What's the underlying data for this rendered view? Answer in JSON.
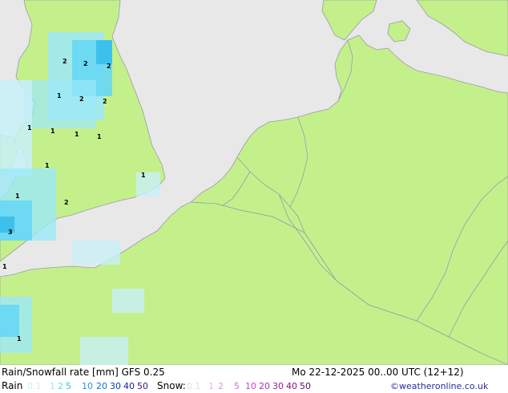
{
  "title": "Rain/Snowfall rate [mm] GFS 0.25",
  "datetime": "Mo 22-12-2025 00..00 UTC (12+12)",
  "credit": "©weatheronline.co.uk",
  "legend": {
    "rain_label": "Rain",
    "snow_label": "Snow:",
    "rain_values": [
      {
        "text": "0.1",
        "color": "#c8f0f8"
      },
      {
        "text": "1",
        "color": "#9ce8f8"
      },
      {
        "text": "2",
        "color": "#64d6f4"
      },
      {
        "text": "5",
        "color": "#34bcec"
      },
      {
        "text": "10",
        "color": "#1c9ce8"
      },
      {
        "text": "20",
        "color": "#1470d0"
      },
      {
        "text": "30",
        "color": "#103cb8"
      },
      {
        "text": "40",
        "color": "#1c1c9c"
      },
      {
        "text": "50",
        "color": "#3c1480"
      }
    ],
    "snow_values": [
      {
        "text": "0.1",
        "color": "#f4d4f4"
      },
      {
        "text": "1",
        "color": "#eab4ea"
      },
      {
        "text": "2",
        "color": "#e090e0"
      },
      {
        "text": "5",
        "color": "#d868d8"
      },
      {
        "text": "10",
        "color": "#c848c8"
      },
      {
        "text": "20",
        "color": "#b030b0"
      },
      {
        "text": "30",
        "color": "#961c96"
      },
      {
        "text": "40",
        "color": "#7c107c"
      },
      {
        "text": "50",
        "color": "#620862"
      }
    ]
  },
  "map_labels": [
    "2",
    "2",
    "2",
    "1",
    "2",
    "2",
    "1",
    "1",
    "1",
    "1",
    "1",
    "1",
    "1",
    "2",
    "3",
    "1",
    "1"
  ],
  "colors": {
    "sea": "#e8e8e8",
    "land": "#c4f08c",
    "border": "#9a9aa6"
  }
}
